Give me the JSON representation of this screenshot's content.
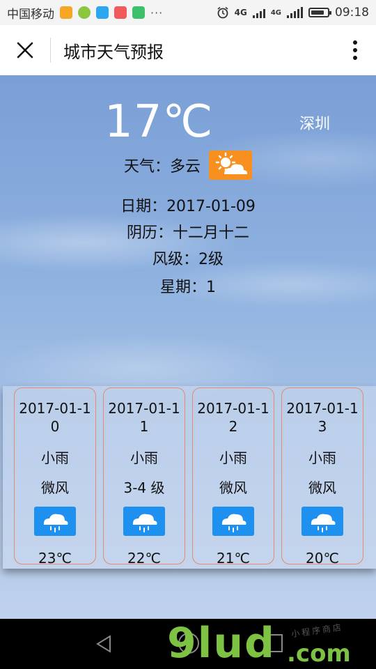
{
  "status_bar": {
    "carrier": "中国移动",
    "dots": "···",
    "network": "4G",
    "network2": "4G",
    "time": "09:18",
    "battery_level": 0.8
  },
  "title_bar": {
    "title": "城市天气预报"
  },
  "current": {
    "temperature": "17℃",
    "city": "深圳",
    "weather_label": "天气：多云",
    "date_label": "日期：2017-01-09",
    "lunar_label": "阴历：十二月十二",
    "wind_label": "风级：2级",
    "weekday_label": "星期：1",
    "icon": "partly-cloudy-icon",
    "icon_color": "#f7901e"
  },
  "forecast": [
    {
      "date": "2017-01-10",
      "condition": "小雨",
      "wind": "微风",
      "temp": "23℃",
      "icon": "rain-icon"
    },
    {
      "date": "2017-01-11",
      "condition": "小雨",
      "wind": "3-4 级",
      "temp": "22℃",
      "icon": "rain-icon"
    },
    {
      "date": "2017-01-12",
      "condition": "小雨",
      "wind": "微风",
      "temp": "21℃",
      "icon": "rain-icon"
    },
    {
      "date": "2017-01-13",
      "condition": "小雨",
      "wind": "微风",
      "temp": "20℃",
      "icon": "rain-icon"
    }
  ],
  "colors": {
    "card_border": "#e58a6e",
    "rain_icon_bg": "#1e90f0",
    "watermark": "#7dc242"
  },
  "watermark": {
    "main": "9lud",
    "suffix": ".com",
    "sub": "小程序商店"
  }
}
